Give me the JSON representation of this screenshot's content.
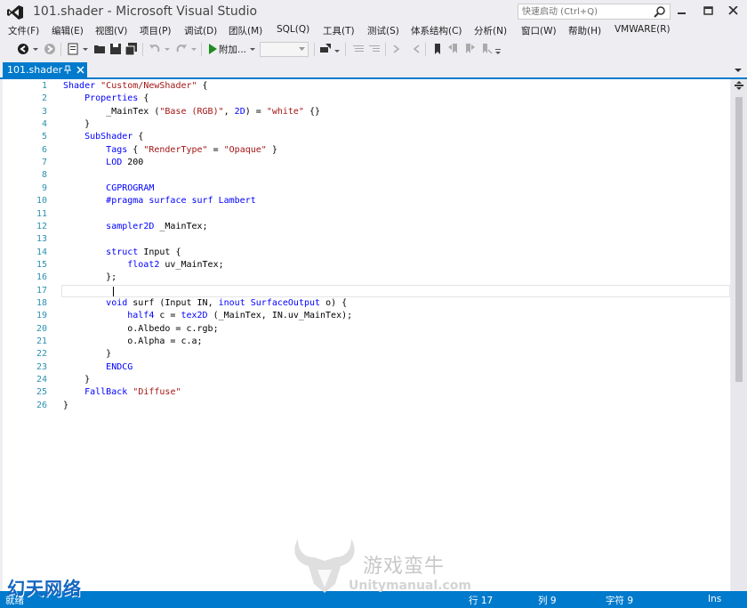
{
  "window": {
    "title": "101.shader - Microsoft Visual Studio",
    "quick_launch_placeholder": "快速启动 (Ctrl+Q)"
  },
  "menu": [
    "文件(F)",
    "编辑(E)",
    "视图(V)",
    "项目(P)",
    "调试(D)",
    "团队(M)",
    "SQL(Q)",
    "工具(T)",
    "测试(S)",
    "体系结构(C)",
    "分析(N)",
    "窗口(W)",
    "帮助(H)",
    "VMWARE(R)"
  ],
  "toolbar": {
    "attach_label": "附加...",
    "attach_value": ""
  },
  "tab": {
    "label": "101.shader"
  },
  "editor": {
    "current_line": 17,
    "line_numbers": [
      "1",
      "2",
      "3",
      "4",
      "5",
      "6",
      "7",
      "8",
      "9",
      "10",
      "11",
      "12",
      "13",
      "14",
      "15",
      "16",
      "17",
      "18",
      "19",
      "20",
      "21",
      "22",
      "23",
      "24",
      "25",
      "26"
    ],
    "lines": [
      [
        [
          "k",
          "Shader "
        ],
        [
          "s",
          "\"Custom/NewShader\""
        ],
        [
          "p",
          " {"
        ]
      ],
      [
        [
          "p",
          "    "
        ],
        [
          "k",
          "Properties"
        ],
        [
          "p",
          " {"
        ]
      ],
      [
        [
          "p",
          "        _MainTex ("
        ],
        [
          "s",
          "\"Base (RGB)\""
        ],
        [
          "p",
          ", "
        ],
        [
          "k",
          "2D"
        ],
        [
          "p",
          ") = "
        ],
        [
          "s",
          "\"white\""
        ],
        [
          "p",
          " {}"
        ]
      ],
      [
        [
          "p",
          "    }"
        ]
      ],
      [
        [
          "p",
          "    "
        ],
        [
          "k",
          "SubShader"
        ],
        [
          "p",
          " {"
        ]
      ],
      [
        [
          "p",
          "        "
        ],
        [
          "k",
          "Tags"
        ],
        [
          "p",
          " { "
        ],
        [
          "s",
          "\"RenderType\""
        ],
        [
          "p",
          " = "
        ],
        [
          "s",
          "\"Opaque\""
        ],
        [
          "p",
          " }"
        ]
      ],
      [
        [
          "p",
          "        "
        ],
        [
          "k",
          "LOD"
        ],
        [
          "p",
          " 200"
        ]
      ],
      [
        [
          "p",
          ""
        ]
      ],
      [
        [
          "p",
          "        "
        ],
        [
          "k",
          "CGPROGRAM"
        ]
      ],
      [
        [
          "p",
          "        "
        ],
        [
          "k",
          "#pragma surface surf Lambert"
        ]
      ],
      [
        [
          "p",
          ""
        ]
      ],
      [
        [
          "p",
          "        "
        ],
        [
          "k",
          "sampler2D"
        ],
        [
          "p",
          " _MainTex;"
        ]
      ],
      [
        [
          "p",
          ""
        ]
      ],
      [
        [
          "p",
          "        "
        ],
        [
          "k",
          "struct"
        ],
        [
          "p",
          " Input {"
        ]
      ],
      [
        [
          "p",
          "            "
        ],
        [
          "k",
          "float2"
        ],
        [
          "p",
          " uv_MainTex;"
        ]
      ],
      [
        [
          "p",
          "        };"
        ]
      ],
      [
        [
          "p",
          ""
        ]
      ],
      [
        [
          "p",
          "        "
        ],
        [
          "k",
          "void"
        ],
        [
          "p",
          " surf (Input IN, "
        ],
        [
          "k",
          "inout"
        ],
        [
          "p",
          " "
        ],
        [
          "k",
          "SurfaceOutput"
        ],
        [
          "p",
          " o) {"
        ]
      ],
      [
        [
          "p",
          "            "
        ],
        [
          "k",
          "half4"
        ],
        [
          "p",
          " c = "
        ],
        [
          "k",
          "tex2D"
        ],
        [
          "p",
          " (_MainTex, IN.uv_MainTex);"
        ]
      ],
      [
        [
          "p",
          "            o.Albedo = c.rgb;"
        ]
      ],
      [
        [
          "p",
          "            o.Alpha = c.a;"
        ]
      ],
      [
        [
          "p",
          "        }"
        ]
      ],
      [
        [
          "p",
          "        "
        ],
        [
          "k",
          "ENDCG"
        ]
      ],
      [
        [
          "p",
          "    }"
        ]
      ],
      [
        [
          "p",
          "    "
        ],
        [
          "k",
          "FallBack"
        ],
        [
          "p",
          " "
        ],
        [
          "s",
          "\"Diffuse\""
        ]
      ],
      [
        [
          "p",
          "}"
        ]
      ]
    ]
  },
  "status": {
    "text": "就绪",
    "line": "行 17",
    "col": "列 9",
    "char": "字符 9",
    "mode": "Ins"
  },
  "watermark": {
    "left": "幻天网络",
    "center_cn": "游戏蛮牛",
    "url": "Unitymanual.com"
  },
  "colors": {
    "accent": "#007acc",
    "keyword": "#0000ff",
    "string": "#a31515",
    "line_number": "#2b91af"
  }
}
